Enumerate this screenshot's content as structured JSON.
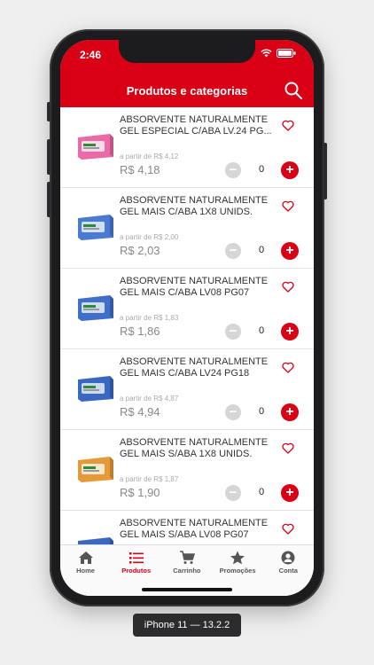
{
  "status_bar": {
    "time": "2:46"
  },
  "header": {
    "title": "Produtos e categorias"
  },
  "products": [
    {
      "name": "ABSORVENTE NATURALMENTE GEL ESPECIAL C/ABA LV.24 PG...",
      "from_label": "a partir de R$ 4,12",
      "price": "R$ 4,18",
      "quantity": "0",
      "package_color": "#e96aa6"
    },
    {
      "name": "ABSORVENTE NATURALMENTE GEL MAIS C/ABA 1X8 UNIDS.",
      "from_label": "a partir de R$ 2,00",
      "price": "R$ 2,03",
      "quantity": "0",
      "package_color": "#4a7bd0"
    },
    {
      "name": "ABSORVENTE NATURALMENTE GEL MAIS C/ABA LV08 PG07",
      "from_label": "a partir de R$ 1,83",
      "price": "R$ 1,86",
      "quantity": "0",
      "package_color": "#3f6fc8"
    },
    {
      "name": "ABSORVENTE NATURALMENTE GEL MAIS C/ABA LV24 PG18",
      "from_label": "a partir de R$ 4,87",
      "price": "R$ 4,94",
      "quantity": "0",
      "package_color": "#3a68c0"
    },
    {
      "name": "ABSORVENTE NATURALMENTE GEL MAIS S/ABA 1X8 UNIDS.",
      "from_label": "a partir de R$ 1,87",
      "price": "R$ 1,90",
      "quantity": "0",
      "package_color": "#e59a3a"
    },
    {
      "name": "ABSORVENTE NATURALMENTE GEL MAIS S/ABA LV08 PG07",
      "from_label": "",
      "price": "",
      "quantity": "",
      "package_color": "#3a68c0"
    }
  ],
  "controls": {
    "minus": "−",
    "plus": "+"
  },
  "tabs": [
    {
      "label": "Home",
      "icon": "home-icon",
      "active": false
    },
    {
      "label": "Produtos",
      "icon": "list-icon",
      "active": true
    },
    {
      "label": "Carrinho",
      "icon": "cart-icon",
      "active": false
    },
    {
      "label": "Promoções",
      "icon": "star-icon",
      "active": false
    },
    {
      "label": "Conta",
      "icon": "account-icon",
      "active": false
    }
  ],
  "device_label": "iPhone 11 — 13.2.2",
  "colors": {
    "brand_red": "#d90016",
    "tab_inactive": "#555555"
  }
}
